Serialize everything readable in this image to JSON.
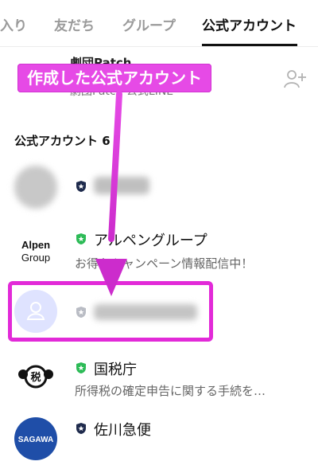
{
  "tabs": [
    {
      "label": "入り"
    },
    {
      "label": "友だち"
    },
    {
      "label": "グループ"
    },
    {
      "label": "公式アカウント",
      "active": true
    }
  ],
  "top_item": {
    "name": "劇団Patch",
    "subtitle": "劇団Patch 公式LINE"
  },
  "callout": {
    "text": "作成した公式アカウント"
  },
  "section": {
    "title": "公式アカウント 6"
  },
  "accounts": [
    {
      "name": "",
      "description": "",
      "badge": "navy-shield-icon",
      "blurred": true
    },
    {
      "name": "アルペングループ",
      "description": "お得なキャンペーン情報配信中！",
      "badge": "green-shield-icon",
      "logo": "Alpen Group"
    },
    {
      "name": "",
      "description": "",
      "badge": "gray-shield-icon",
      "blurred": true,
      "highlighted": true
    },
    {
      "name": "国税庁",
      "description": "所得税の確定申告に関する手続を…",
      "badge": "green-shield-icon",
      "logo": "税"
    },
    {
      "name": "佐川急便",
      "description": "",
      "badge": "navy-shield-icon",
      "logo": "SAGAWA"
    }
  ],
  "colors": {
    "accent_magenta": "#e22ad8",
    "badge_green": "#2dbb57",
    "badge_navy": "#1f2b4d",
    "badge_gray": "#b9bcc4",
    "tab_inactive": "#9a9a9a"
  }
}
